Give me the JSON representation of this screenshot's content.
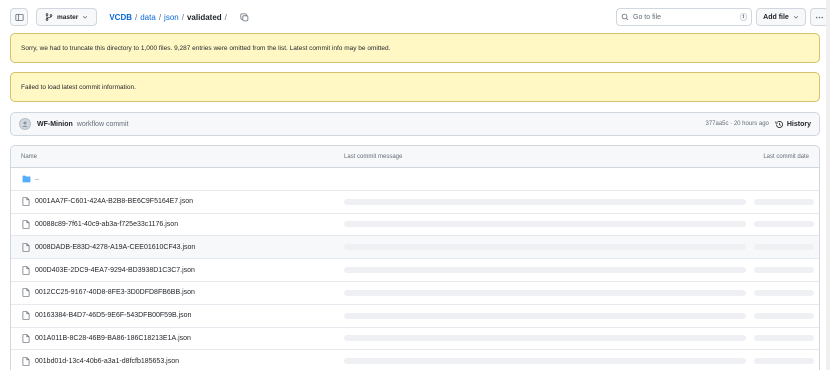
{
  "topbar": {
    "branch": "master",
    "breadcrumb": {
      "repo": "VCDB",
      "parts": [
        "data",
        "json"
      ],
      "current": "validated",
      "trailing_sep": "/"
    },
    "goto_placeholder": "Go to file",
    "goto_shortcut": "t",
    "add_file_label": "Add file"
  },
  "warnings": {
    "truncate": "Sorry, we had to truncate this directory to 1,000 files. 9,287 entries were omitted from the list. Latest commit info may be omitted.",
    "commit_fail": "Failed to load latest commit information."
  },
  "commit": {
    "author": "WF-Minion",
    "message": "workflow commit",
    "meta": "377aa5c · 20 hours ago",
    "history_label": "History"
  },
  "table": {
    "headers": {
      "name": "Name",
      "message": "Last commit message",
      "date": "Last commit date"
    },
    "parent_dir": "..",
    "files": [
      "0001AA7F-C601-424A-B2B8-BE6C9F5164E7.json",
      "00088c89-7f61-40c9-ab3a-f725e33c1176.json",
      "0008DADB-E83D-4278-A19A-CEE01610CF43.json",
      "000D403E-2DC9-4EA7-9294-BD3938D1C3C7.json",
      "0012CC25-9167-40D8-8FE3-3D0DFD8FB6BB.json",
      "00163384-B4D7-46D5-9E6F-543DFB00F59B.json",
      "001A011B-8C28-46B9-BA86-186C18213E1A.json",
      "001bd01d-13c4-40b6-a3a1-d8fcfb185653.json"
    ]
  },
  "colors": {
    "link": "#0969da",
    "warning_bg": "#fff8c5",
    "folder": "#54aeff"
  }
}
